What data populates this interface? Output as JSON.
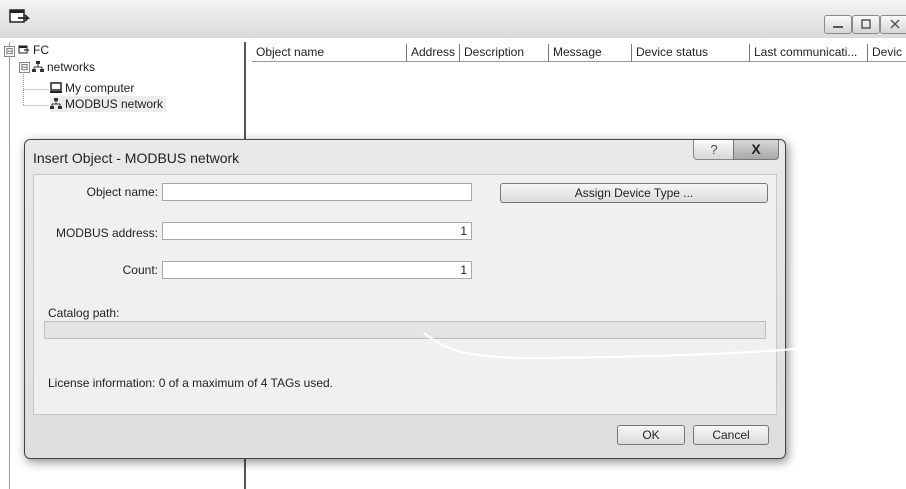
{
  "window": {
    "icon": "application-icon",
    "controls": [
      "minimize-icon",
      "maximize-icon",
      "close-icon"
    ]
  },
  "tree": {
    "root": {
      "label": "FC",
      "expander": "⊟"
    },
    "networks": {
      "label": "networks",
      "expander": "⊟"
    },
    "items": [
      {
        "label": "My computer",
        "icon": "computer-icon"
      },
      {
        "label": "MODBUS network",
        "icon": "network-icon"
      }
    ]
  },
  "list": {
    "columns": [
      "Object name",
      "Address",
      "Description",
      "Message",
      "Device status",
      "Last communicati...",
      "Devic"
    ]
  },
  "dialog": {
    "title": "Insert Object - MODBUS network",
    "help_label": "?",
    "close_label": "X",
    "object_name_label": "Object name:",
    "object_name_value": "",
    "modbus_address_label": "MODBUS address:",
    "modbus_address_value": "1",
    "count_label": "Count:",
    "count_value": "1",
    "assign_button": "Assign Device Type ...",
    "catalog_path_label": "Catalog path:",
    "catalog_path_value": "",
    "license_info": "License information: 0 of a maximum of 4 TAGs used.",
    "ok_button": "OK",
    "cancel_button": "Cancel"
  }
}
